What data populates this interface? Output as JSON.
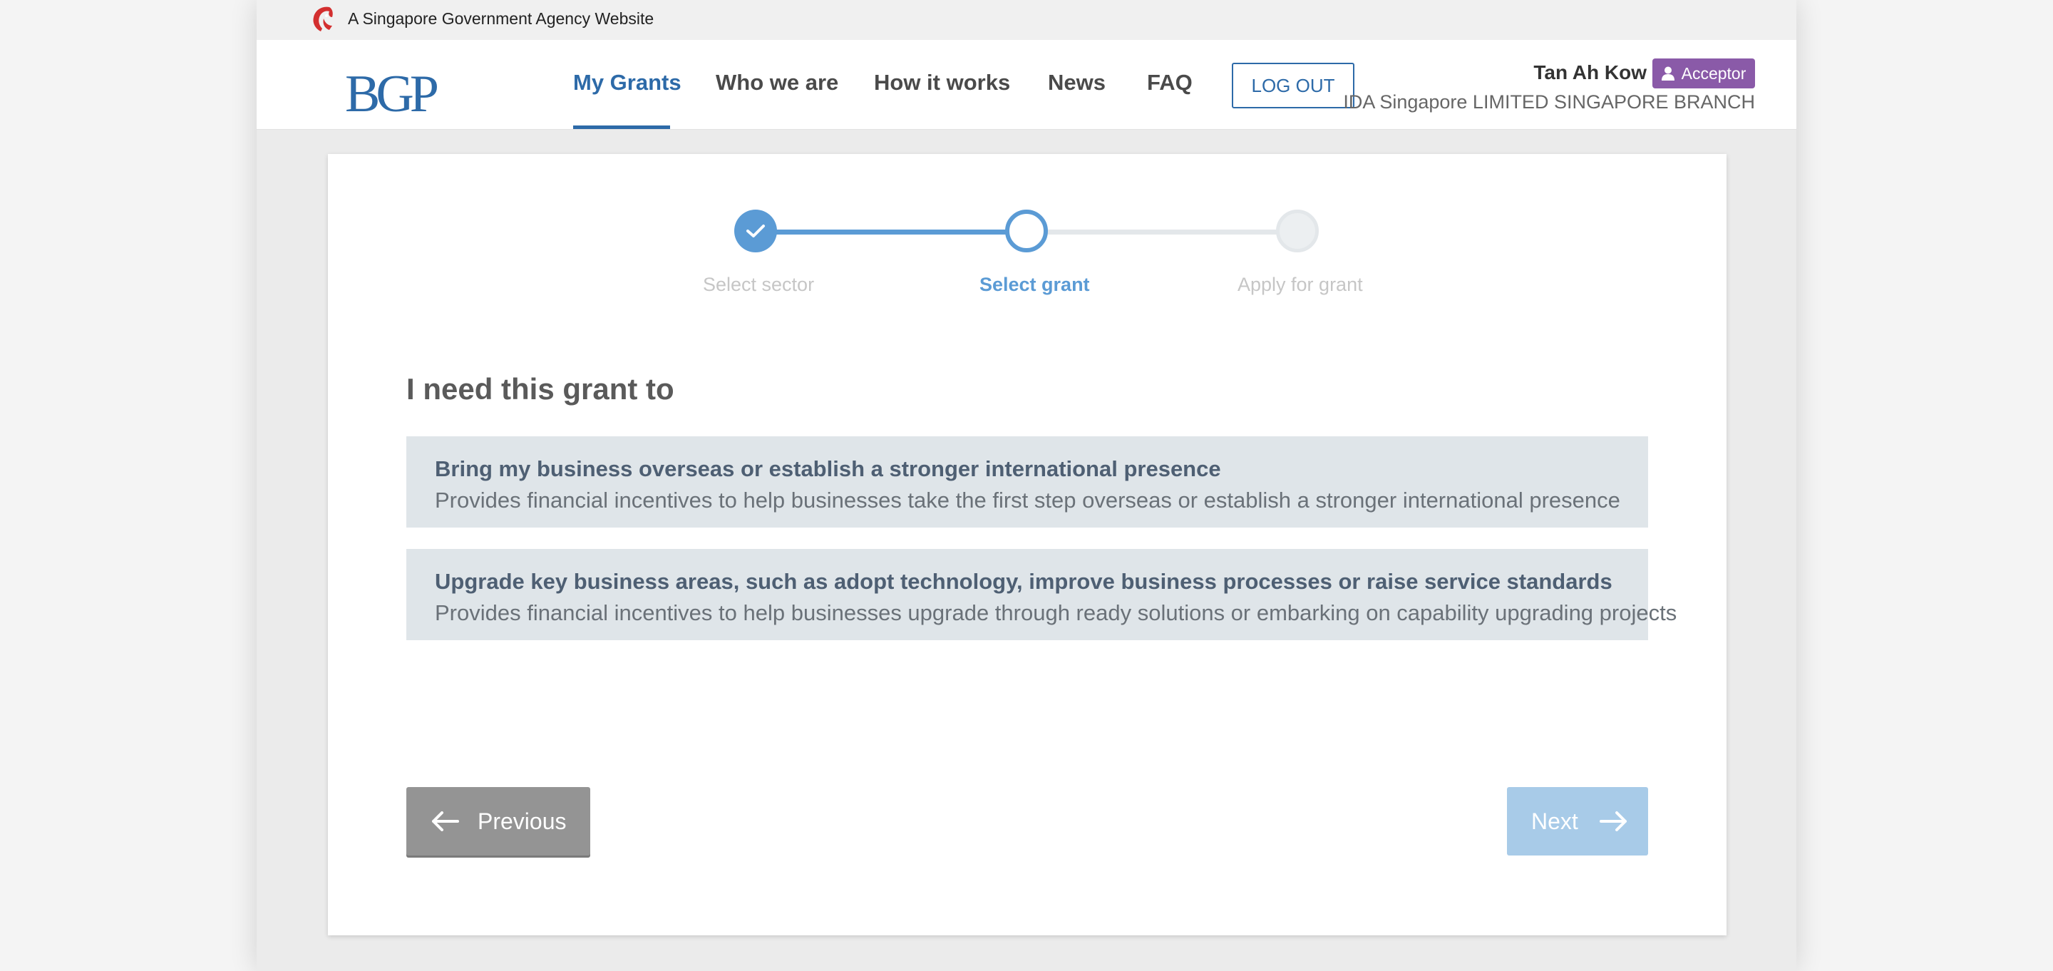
{
  "masthead": {
    "text": "A Singapore Government Agency Website"
  },
  "header": {
    "logo_text": "BGP",
    "nav": [
      {
        "label": "My Grants",
        "active": true
      },
      {
        "label": "Who we are"
      },
      {
        "label": "How it works"
      },
      {
        "label": "News"
      },
      {
        "label": "FAQ"
      }
    ],
    "logout_label": "LOG OUT",
    "user_name": "Tan Ah Kow",
    "role_badge": "Acceptor",
    "company_name": "IDA Singapore LIMITED SINGAPORE BRANCH"
  },
  "stepper": {
    "steps": [
      {
        "label": "Select sector",
        "state": "completed"
      },
      {
        "label": "Select grant",
        "state": "current"
      },
      {
        "label": "Apply for grant",
        "state": "upcoming"
      }
    ]
  },
  "main": {
    "question": "I need this grant to",
    "options": [
      {
        "title": "Bring my business overseas or establish a stronger international presence",
        "description": "Provides financial incentives to help businesses take the first step overseas or establish a stronger international presence"
      },
      {
        "title": "Upgrade key business areas, such as adopt technology, improve business processes or raise service standards",
        "description": "Provides financial incentives to help businesses upgrade through ready solutions or embarking on capability upgrading projects"
      }
    ],
    "previous_label": "Previous",
    "next_label": "Next"
  },
  "colors": {
    "primary": "#2d6aa8",
    "stepper_active": "#5b9bd5",
    "badge": "#8a5aa8",
    "option_bg": "#dfe5e9",
    "previous_bg": "#949494",
    "next_disabled_bg": "#a8cbe8",
    "lion_red": "#d32f2f"
  },
  "icons": {
    "masthead": "lion-head-icon",
    "badge": "person-icon",
    "step_done": "check-icon",
    "previous": "arrow-left-icon",
    "next": "arrow-right-icon"
  }
}
